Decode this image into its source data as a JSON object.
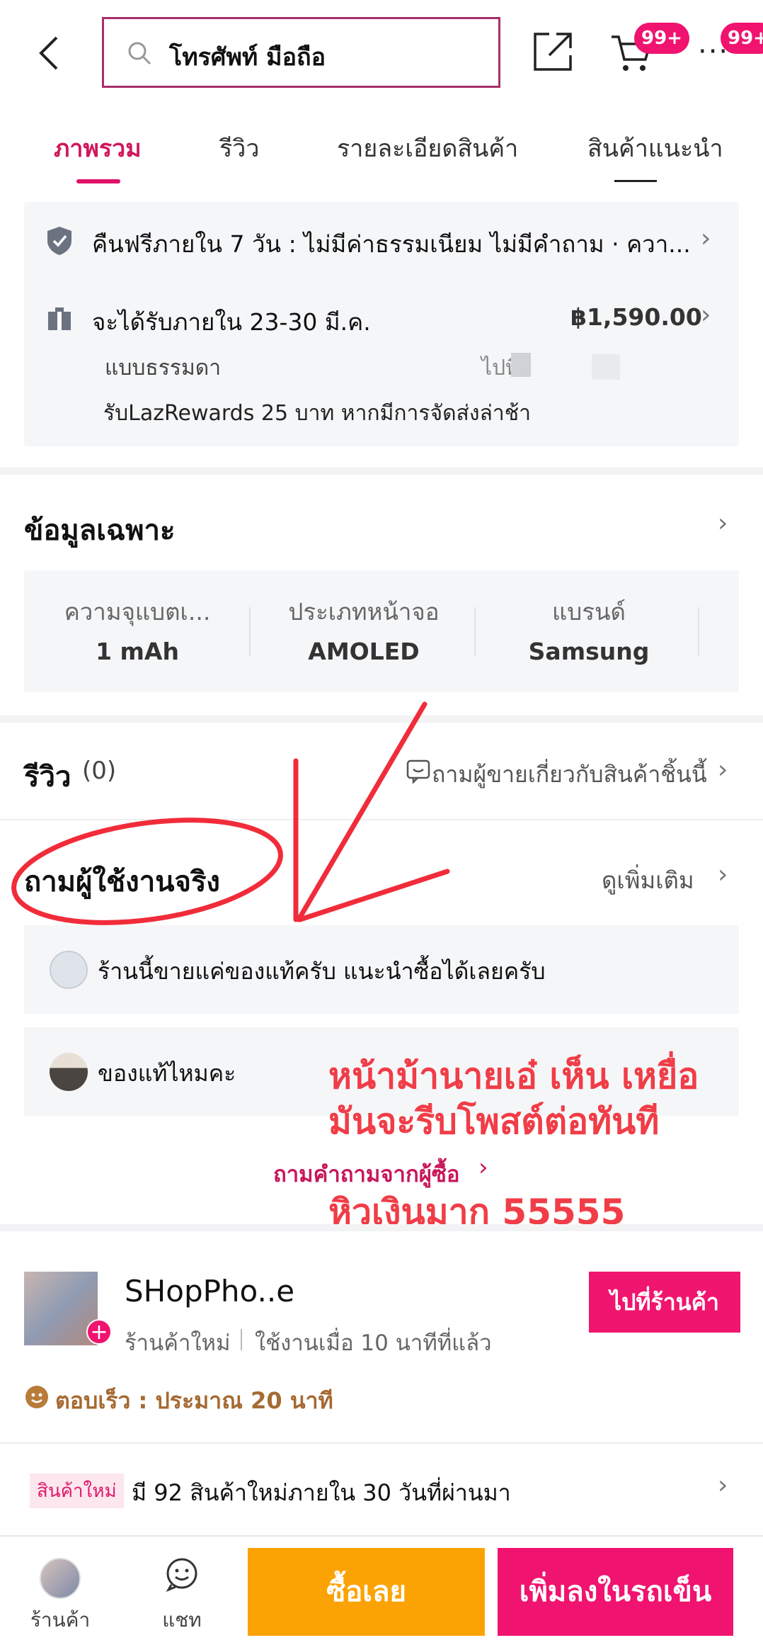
{
  "header": {
    "search_value": "โทรศัพท์ มือถือ",
    "cart_badge": "99+",
    "more_badge": "99+"
  },
  "tabs": [
    {
      "label": "ภาพรวม",
      "active": true
    },
    {
      "label": "รีวิว",
      "active": false
    },
    {
      "label": "รายละเอียดสินค้า",
      "active": false
    },
    {
      "label": "สินค้าแนะนำ",
      "active": false
    }
  ],
  "service": {
    "return_text": "คืนฟรีภายใน 7 วัน : ไม่มีค่าธรรมเนียม ไม่มีคำถาม · ควา...",
    "delivery_text": "จะได้รับภายใน 23-30 มี.ค.",
    "delivery_price": "฿1,590.00",
    "delivery_type": "แบบธรรมดา",
    "delivery_dest": "ไปที่",
    "rewards_text": "รับLazRewards 25 บาท หากมีการจัดส่งล่าช้า"
  },
  "specs": {
    "title": "ข้อมูลเฉพาะ",
    "items": [
      {
        "label": "ความจุแบตเ...",
        "value": "1 mAh"
      },
      {
        "label": "ประเภทหน้าจอ",
        "value": "AMOLED"
      },
      {
        "label": "แบรนด์",
        "value": "Samsung"
      }
    ]
  },
  "reviews": {
    "title": "รีวิว",
    "count": "(0)",
    "ask_seller": "ถามผู้ขายเกี่ยวกับสินค้าชิ้นนี้"
  },
  "qa": {
    "title": "ถามผู้ใช้งานจริง",
    "see_more": "ดูเพิ่มเติม",
    "items": [
      {
        "text": "ร้านนี้ขายแค่ของแท้ครับ แนะนำซื้อได้เลยครับ"
      },
      {
        "text": "ของแท้ไหมคะ"
      }
    ],
    "ask_link": "ถามคำถามจากผู้ซื้อ"
  },
  "annotation": {
    "line1": "หน้าม้านายเอ๋ เห็น เหยื่อ",
    "line2": "มันจะรีบโพสต์ต่อทันที",
    "line3": "หิวเงินมาก 55555",
    "color": "#f03d47"
  },
  "shop": {
    "name": "SHopPho..e",
    "status": "ร้านค้าใหม่",
    "last_active": "ใช้งานเมื่อ 10 นาทีที่แล้ว",
    "goto_button": "ไปที่ร้านค้า",
    "response": "ตอบเร็ว : ประมาณ 20 นาที",
    "new_badge": "สินค้าใหม่",
    "new_items_text": "มี 92 สินค้าใหม่ภายใน 30 วันที่ผ่านมา"
  },
  "bottom_nav": {
    "store_label": "ร้านค้า",
    "chat_label": "แชท",
    "buy_now": "ซื้อเลย",
    "add_to_cart": "เพิ่มลงในรถเข็น"
  },
  "colors": {
    "accent": "#f0136f",
    "buy": "#fba305"
  }
}
